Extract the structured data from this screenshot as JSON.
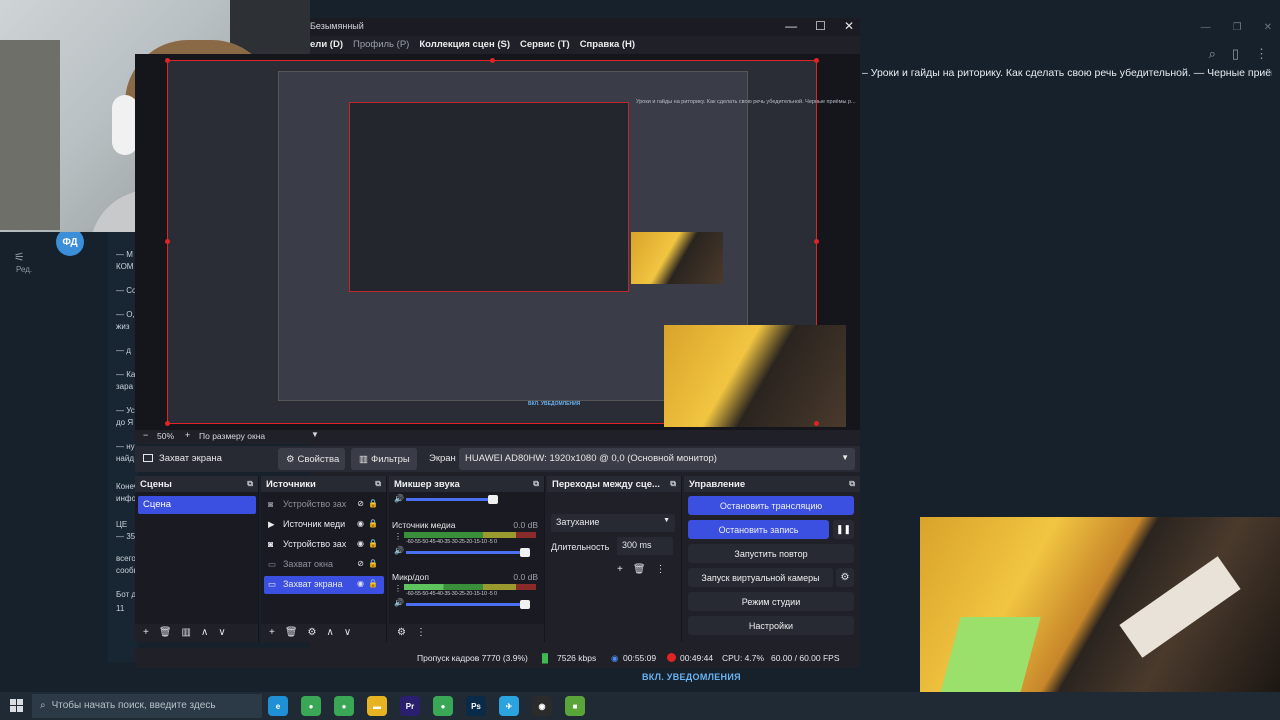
{
  "background": {
    "header_text": "– Уроки и гайды на риторику. Как сделать свою речь убедительной.  — Черные приёмы р...",
    "avatar_initials": "ФД",
    "left_label": "Ред.",
    "chat_lines": [
      "— М",
      "КОМ",
      "— Со",
      "— О,",
      "жиз",
      "— д",
      "— Ка",
      "зара",
      "— Ус",
      "до Я",
      "— ну",
      "найд",
      "Конеч",
      "инфор",
      "ЦЕ",
      "— 350",
      "всего",
      "сообщ",
      "Бот д",
      "11"
    ],
    "notifications": "ВКЛ. УВЕДОМЛЕНИЯ"
  },
  "obs": {
    "title": "Безымянный",
    "menu": [
      "ели (D)",
      "Профиль (P)",
      "Коллекция сцен (S)",
      "Сервис (T)",
      "Справка (H)"
    ],
    "preview": {
      "zoom": "50%",
      "fit": "По размеру окна",
      "nested_text": "Уроки и гайды на риторику. Как сделать свою речь убедительной.     Черные приёмы р...",
      "nested_notif": "ВКЛ. УВЕДОМЛЕНИЯ"
    },
    "source_toolbar": {
      "source_name": "Захват экрана",
      "properties": "Свойства",
      "filters": "Фильтры",
      "screen_label": "Экран",
      "screen_value": "HUAWEI AD80HW: 1920x1080 @ 0,0 (Основной монитор)"
    },
    "scenes": {
      "title": "Сцены",
      "items": [
        "Сцена"
      ]
    },
    "sources": {
      "title": "Источники",
      "items": [
        {
          "name": "Устройство зах",
          "icon": "camera",
          "visible": false
        },
        {
          "name": "Источник меди",
          "icon": "play",
          "visible": true
        },
        {
          "name": "Устройство зах",
          "icon": "camera",
          "visible": true
        },
        {
          "name": "Захват окна",
          "icon": "window",
          "visible": false
        },
        {
          "name": "Захват экрана",
          "icon": "monitor",
          "visible": true,
          "selected": true
        }
      ]
    },
    "mixer": {
      "title": "Микшер звука",
      "scale": "-60-55-50-45-40-35-30-25-20-15-10 -5  0",
      "channels": [
        {
          "name": "",
          "db": ""
        },
        {
          "name": "Источник медиа",
          "db": "0.0 dB"
        },
        {
          "name": "Микр/доп",
          "db": "0.0 dB"
        }
      ]
    },
    "transitions": {
      "title": "Переходы между сце...",
      "selected": "Затухание",
      "duration_label": "Длительность",
      "duration_value": "300 ms"
    },
    "controls": {
      "title": "Управление",
      "stop_stream": "Остановить трансляцию",
      "stop_record": "Остановить запись",
      "start_replay": "Запустить повтор",
      "start_virtualcam": "Запуск виртуальной камеры",
      "studio_mode": "Режим студии",
      "settings": "Настройки"
    },
    "status": {
      "dropped_frames": "Пропуск кадров 7770 (3.9%)",
      "bitrate": "7526 kbps",
      "stream_time": "00:55:09",
      "record_time": "00:49:44",
      "cpu": "CPU: 4.7%",
      "fps": "60.00 / 60.00 FPS"
    }
  },
  "taskbar": {
    "search_placeholder": "Чтобы начать поиск, введите здесь",
    "apps": [
      {
        "name": "edge-app",
        "color": "#1f8fd6",
        "label": "e"
      },
      {
        "name": "chrome-app-1",
        "color": "#3aa757",
        "label": "●"
      },
      {
        "name": "chrome-app-2",
        "color": "#3aa757",
        "label": "●"
      },
      {
        "name": "explorer-app",
        "color": "#e6b422",
        "label": "▬"
      },
      {
        "name": "premiere-app",
        "color": "#2a1f6e",
        "label": "Pr"
      },
      {
        "name": "chrome-app-3",
        "color": "#3aa757",
        "label": "●"
      },
      {
        "name": "photoshop-app",
        "color": "#0a2a4a",
        "label": "Ps"
      },
      {
        "name": "telegram-app",
        "color": "#2aa3df",
        "label": "✈"
      },
      {
        "name": "obs-app",
        "color": "#2b2b2b",
        "label": "◉"
      },
      {
        "name": "minecraft-app",
        "color": "#5aa53a",
        "label": "■"
      }
    ]
  }
}
